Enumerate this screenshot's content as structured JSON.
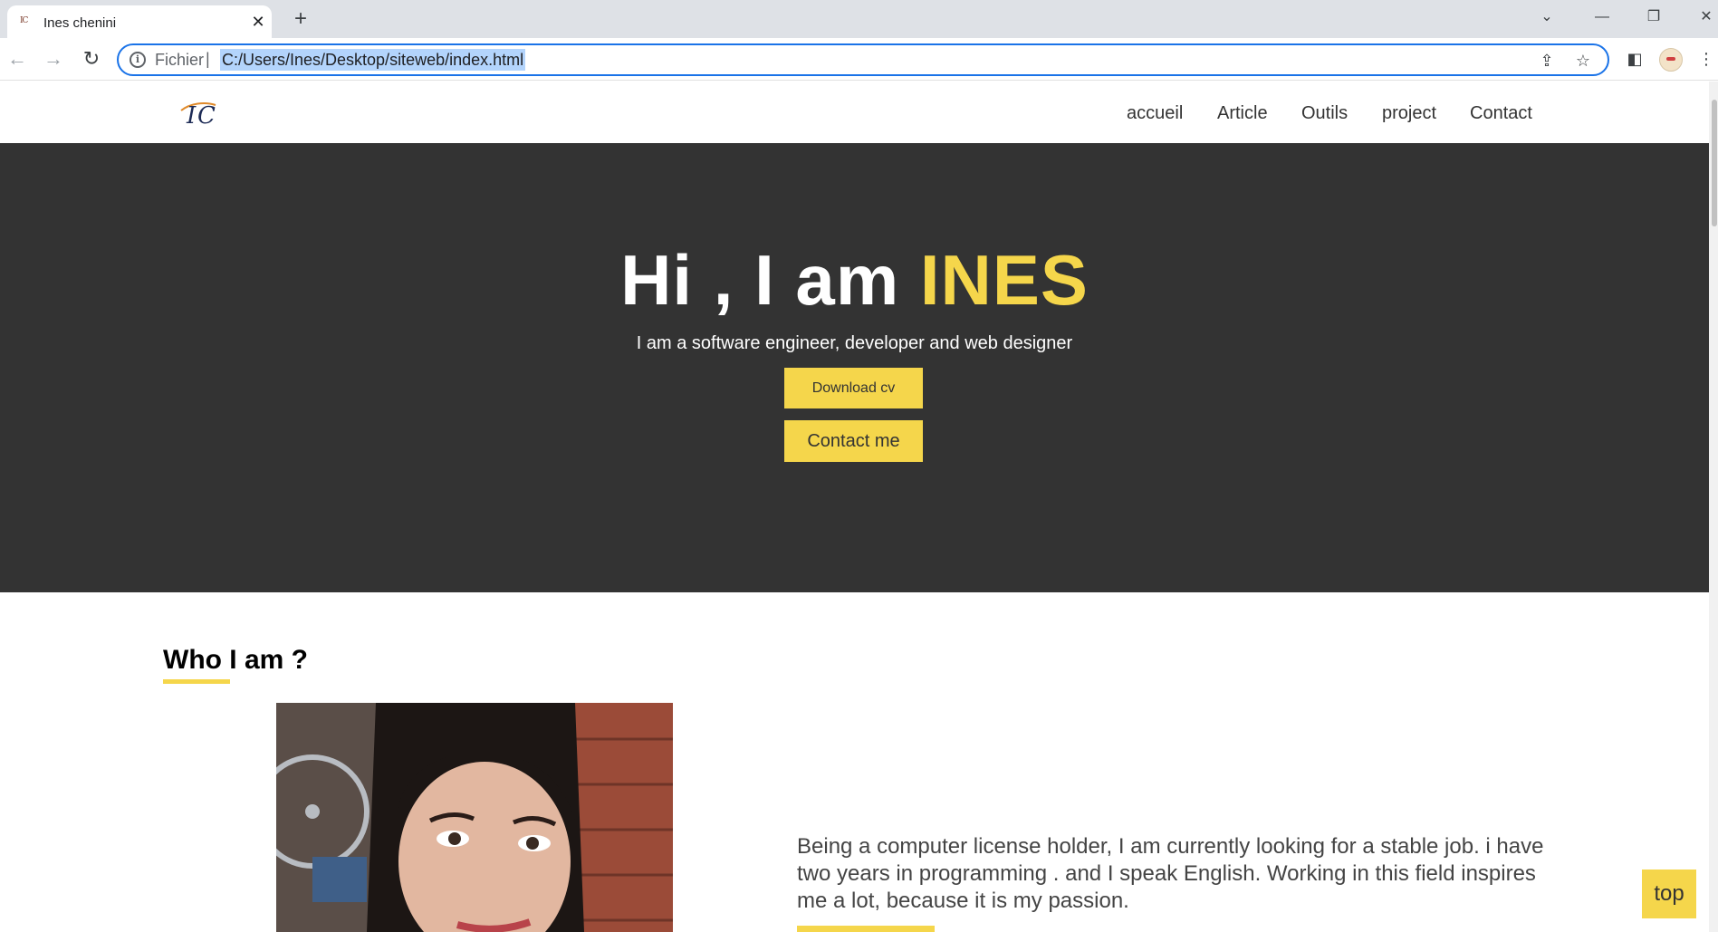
{
  "browser": {
    "tab_title": "Ines chenini",
    "tab_favicon": "IC",
    "new_tab": "+",
    "address_scheme": "Fichier",
    "address_url": "C:/Users/Ines/Desktop/siteweb/index.html",
    "icons": [
      "back-icon",
      "forward-icon",
      "reload-icon",
      "info-icon",
      "share-icon",
      "star-icon",
      "side-panel-icon",
      "profile-avatar",
      "menu-icon",
      "tab-search-icon",
      "minimize-icon",
      "restore-icon",
      "close-window-icon"
    ]
  },
  "site": {
    "nav": [
      "accueil",
      "Article",
      "Outils",
      "project",
      "Contact"
    ],
    "hero": {
      "greeting": "Hi , I am ",
      "name": "INES",
      "subtitle": "I am a software engineer, developer and web designer",
      "download_cv": "Download cv",
      "contact_me": "Contact me"
    },
    "about": {
      "title": "Who I am ?",
      "text": "Being a computer license holder, I am currently looking for a stable job. i have two years in programming . and I speak English. Working in this field inspires me a lot, because it is my passion."
    },
    "back_to_top": "top"
  },
  "colors": {
    "accent": "#f5d64b",
    "hero_bg": "#333333",
    "address_focus": "#1a73e8"
  }
}
